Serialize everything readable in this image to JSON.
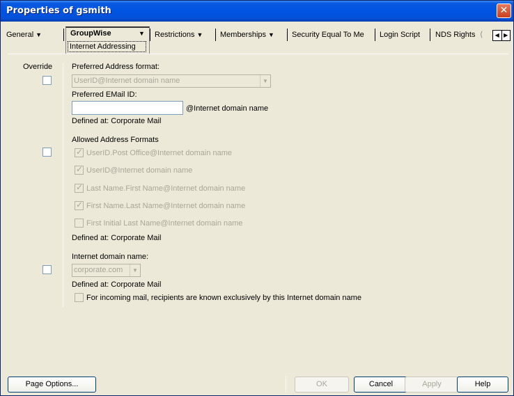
{
  "window": {
    "title": "Properties of gsmith",
    "close_glyph": "✕"
  },
  "tabs": [
    {
      "label": "General",
      "has_menu": true
    },
    {
      "label": "GroupWise",
      "has_menu": true,
      "active": true,
      "sublabel": "Internet Addressing"
    },
    {
      "label": "Restrictions",
      "has_menu": true
    },
    {
      "label": "Memberships",
      "has_menu": true
    },
    {
      "label": "Security Equal To Me",
      "has_menu": false
    },
    {
      "label": "Login Script",
      "has_menu": false
    },
    {
      "label": "NDS Rights",
      "has_menu": false,
      "truncated": true
    }
  ],
  "arrow_glyph": "▼",
  "scroll": {
    "left": "◀",
    "right": "▶"
  },
  "override_label": "Override",
  "section1": {
    "preferred_format_label": "Preferred Address format:",
    "preferred_format_value": "UserID@Internet domain name",
    "preferred_email_label": "Preferred EMail ID:",
    "preferred_email_value": "",
    "email_suffix": "@Internet domain name",
    "defined_at": "Defined at:  Corporate Mail"
  },
  "section2": {
    "heading": "Allowed Address Formats",
    "formats": [
      {
        "label": "UserID.Post Office@Internet domain name",
        "checked": true
      },
      {
        "label": "UserID@Internet domain name",
        "checked": true
      },
      {
        "label": "Last Name.First Name@Internet domain name",
        "checked": true
      },
      {
        "label": "First Name.Last Name@Internet domain name",
        "checked": true
      },
      {
        "label": "First Initial Last Name@Internet domain name",
        "checked": false
      }
    ],
    "defined_at": "Defined at:  Corporate Mail"
  },
  "section3": {
    "domain_label": "Internet domain name:",
    "domain_value": "corporate.com",
    "defined_at": "Defined at:  Corporate Mail",
    "exclusive_label": "For incoming mail, recipients are known exclusively by this Internet domain name"
  },
  "buttons": {
    "page_options": "Page Options...",
    "ok": "OK",
    "cancel": "Cancel",
    "apply": "Apply",
    "help": "Help"
  }
}
